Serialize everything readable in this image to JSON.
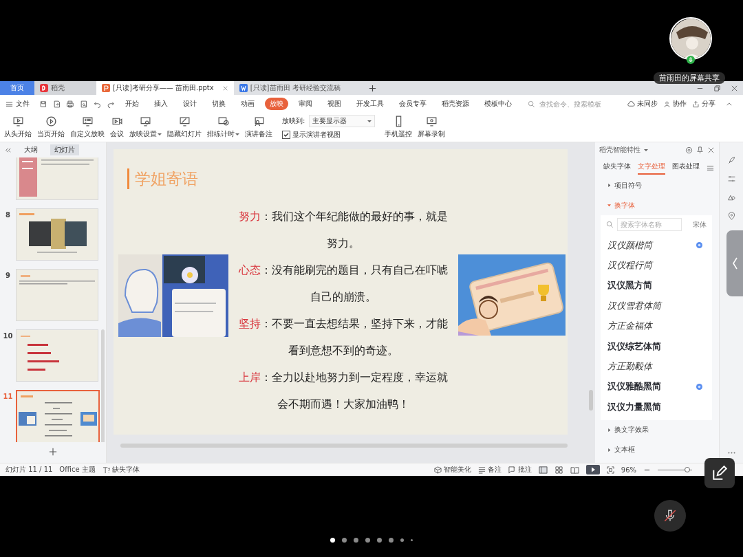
{
  "share_overlay": {
    "label": "苗雨田的屏幕共享"
  },
  "window": {
    "tabs": [
      {
        "label": "首页",
        "kind": "home",
        "selected": false
      },
      {
        "label": "稻壳",
        "kind": "docer",
        "selected": false
      },
      {
        "label": "[只读]考研分享—— 苗雨田.pptx",
        "kind": "ppt",
        "selected": true
      },
      {
        "label": "[只读]苗雨田 考研经验交流稿",
        "kind": "doc",
        "selected": false
      }
    ],
    "file_menu": "文件",
    "menu": [
      {
        "label": "开始",
        "selected": false
      },
      {
        "label": "插入",
        "selected": false
      },
      {
        "label": "设计",
        "selected": false
      },
      {
        "label": "切换",
        "selected": false
      },
      {
        "label": "动画",
        "selected": false
      },
      {
        "label": "放映",
        "selected": true
      },
      {
        "label": "审阅",
        "selected": false
      },
      {
        "label": "视图",
        "selected": false
      },
      {
        "label": "开发工具",
        "selected": false
      },
      {
        "label": "会员专享",
        "selected": false
      },
      {
        "label": "稻壳资源",
        "selected": false
      },
      {
        "label": "模板中心",
        "selected": false
      }
    ],
    "search": {
      "placeholder": "查找命令、搜索模板"
    },
    "actions": [
      "未同步",
      "协作",
      "分享"
    ],
    "toolbar": [
      {
        "label": "从头开始",
        "dropdown": false
      },
      {
        "label": "当页开始",
        "dropdown": false
      },
      {
        "label": "自定义放映",
        "dropdown": false
      },
      {
        "label": "会议",
        "dropdown": false
      },
      {
        "label": "放映设置",
        "dropdown": true
      },
      {
        "label": "隐藏幻灯片",
        "dropdown": false
      },
      {
        "label": "排练计时",
        "dropdown": true
      },
      {
        "label": "演讲备注",
        "dropdown": false
      }
    ],
    "display_to": {
      "label": "放映到:",
      "value": "主要显示器"
    },
    "presenter_view": {
      "label": "显示演讲者视图",
      "checked": true
    },
    "toolbar_right": [
      {
        "label": "手机遥控"
      },
      {
        "label": "屏幕录制"
      }
    ],
    "panel_tabs": [
      {
        "label": "大纲",
        "selected": false
      },
      {
        "label": "幻灯片",
        "selected": true
      }
    ],
    "thumbnails": [
      {
        "kind": "sidebar",
        "selected": false
      },
      {
        "number": "8",
        "kind": "photos",
        "selected": false
      },
      {
        "number": "9",
        "kind": "text",
        "selected": false
      },
      {
        "number": "10",
        "kind": "list",
        "selected": false
      },
      {
        "number": "11",
        "kind": "current",
        "selected": true
      }
    ],
    "slide": {
      "title": "学姐寄语",
      "paragraphs": [
        {
          "label": "努力",
          "text": "：我们这个年纪能做的最好的事，就是努力。"
        },
        {
          "label": "心态",
          "text": "：没有能刷完的题目，只有自己在吓唬自己的崩溃。"
        },
        {
          "label": "坚持",
          "text": "：不要一直去想结果，坚持下来，才能看到意想不到的奇迹。"
        },
        {
          "label": "上岸",
          "text": "：全力以赴地努力到一定程度，幸运就会不期而遇！大家加油鸭！"
        }
      ]
    },
    "side_panel": {
      "title": "稻壳智能特性",
      "tabs": [
        {
          "label": "缺失字体",
          "selected": false
        },
        {
          "label": "文字处理",
          "selected": true
        },
        {
          "label": "图表处理",
          "selected": false
        }
      ],
      "sections": [
        {
          "label": "项目符号",
          "expanded": false
        },
        {
          "label": "换字体",
          "expanded": true
        }
      ],
      "font_search": {
        "placeholder": "搜索字体名称",
        "current_font": "宋体"
      },
      "fonts": [
        {
          "name": "汉仪颜楷简",
          "kind": "script",
          "marked": true
        },
        {
          "name": "汉仪程行简",
          "kind": "script",
          "marked": false
        },
        {
          "name": "汉仪黑方简",
          "kind": "bold",
          "marked": false
        },
        {
          "name": "汉仪雪君体简",
          "kind": "script",
          "marked": false
        },
        {
          "name": "方正金福体",
          "kind": "script",
          "marked": false
        },
        {
          "name": "汉仪综艺体简",
          "kind": "bold",
          "marked": false
        },
        {
          "name": "方正勤毅体",
          "kind": "script",
          "marked": false
        },
        {
          "name": "汉仪雅酷黑简",
          "kind": "bold",
          "marked": true
        },
        {
          "name": "汉仪力量黑简",
          "kind": "bold",
          "marked": false
        }
      ],
      "more_sections": [
        {
          "label": "换文字效果",
          "expanded": false
        },
        {
          "label": "文本框",
          "expanded": false
        }
      ]
    },
    "status_bar": {
      "slide_counter": "幻灯片 11 / 11",
      "theme": "Office 主题",
      "missing_fonts": "缺失字体",
      "beautify": "智能美化",
      "notes": "备注",
      "comments": "批注",
      "zoom": "96%",
      "zoom_slider": {
        "level": 0.85
      }
    }
  },
  "pager": [
    {
      "selected": true
    },
    {
      "selected": false
    },
    {
      "selected": false
    },
    {
      "selected": false
    },
    {
      "selected": false
    },
    {
      "selected": false
    },
    {
      "selected": false
    },
    {
      "selected": false
    }
  ]
}
